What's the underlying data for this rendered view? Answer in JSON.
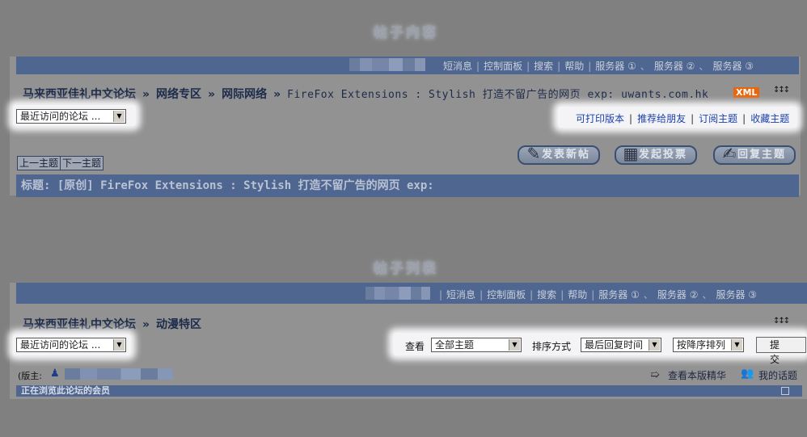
{
  "section1": {
    "title": "帖子内容",
    "topnav": [
      "短消息",
      "控制面板",
      "搜索",
      "帮助",
      "服务器 ①",
      "服务器 ②",
      "服务器 ③"
    ],
    "topnav_separators": [
      "|",
      "|",
      "|",
      "|",
      "、",
      "、"
    ],
    "breadcrumb": {
      "home": "马来西亚佳礼中文论坛",
      "sep": "»",
      "level1": "网络专区",
      "level2": "网际网络",
      "thread": "FireFox Extensions : Stylish 打造不留广告的网页 exp: uwants.com.hk",
      "xml_badge": "XML",
      "expand_glyph": "↕↕↕"
    },
    "recent_forums": "最近访问的论坛 ...",
    "links": [
      "可打印版本",
      "推荐给朋友",
      "订阅主题",
      "收藏主题"
    ],
    "link_sep": "|",
    "prev_thread": "上一主题",
    "next_thread": "下一主题",
    "new_post": "发表新帖",
    "new_poll": "发起投票",
    "reply": "回复主题",
    "subject": "标题: [原创] FireFox Extensions : Stylish 打造不留广告的网页 exp:"
  },
  "section2": {
    "title": "帖子列表",
    "topnav": [
      "短消息",
      "控制面板",
      "搜索",
      "帮助",
      "服务器 ①",
      "服务器 ②",
      "服务器 ③"
    ],
    "topnav_separators": [
      "|",
      "|",
      "|",
      "|",
      "、",
      "、"
    ],
    "breadcrumb": {
      "home": "马来西亚佳礼中文论坛",
      "sep": "»",
      "level1": "动漫特区",
      "expand_glyph": "↕↕↕"
    },
    "recent_forums": "最近访问的论坛 ...",
    "view_label": "查看",
    "view_value": "全部主题",
    "sort_label": "排序方式",
    "sort_value": "最后回复时间",
    "order_value": "按降序排列",
    "submit": "提 交",
    "moderator_label": "(版主:",
    "digest_link": "查看本版精华",
    "my_topics_link": "我的话题",
    "browsing_members": "正在浏览此论坛的会员"
  },
  "icons": {
    "dropdown": "triangle-down",
    "new_post": "pencil",
    "poll": "ballot",
    "reply": "reply-pen",
    "digest": "arrow-right",
    "my_topics": "users",
    "moderator": "person",
    "collapse": "square"
  },
  "colors": {
    "nav_bar": "#4f6690",
    "link": "#1b3fae",
    "xml_badge": "#e8650c"
  }
}
